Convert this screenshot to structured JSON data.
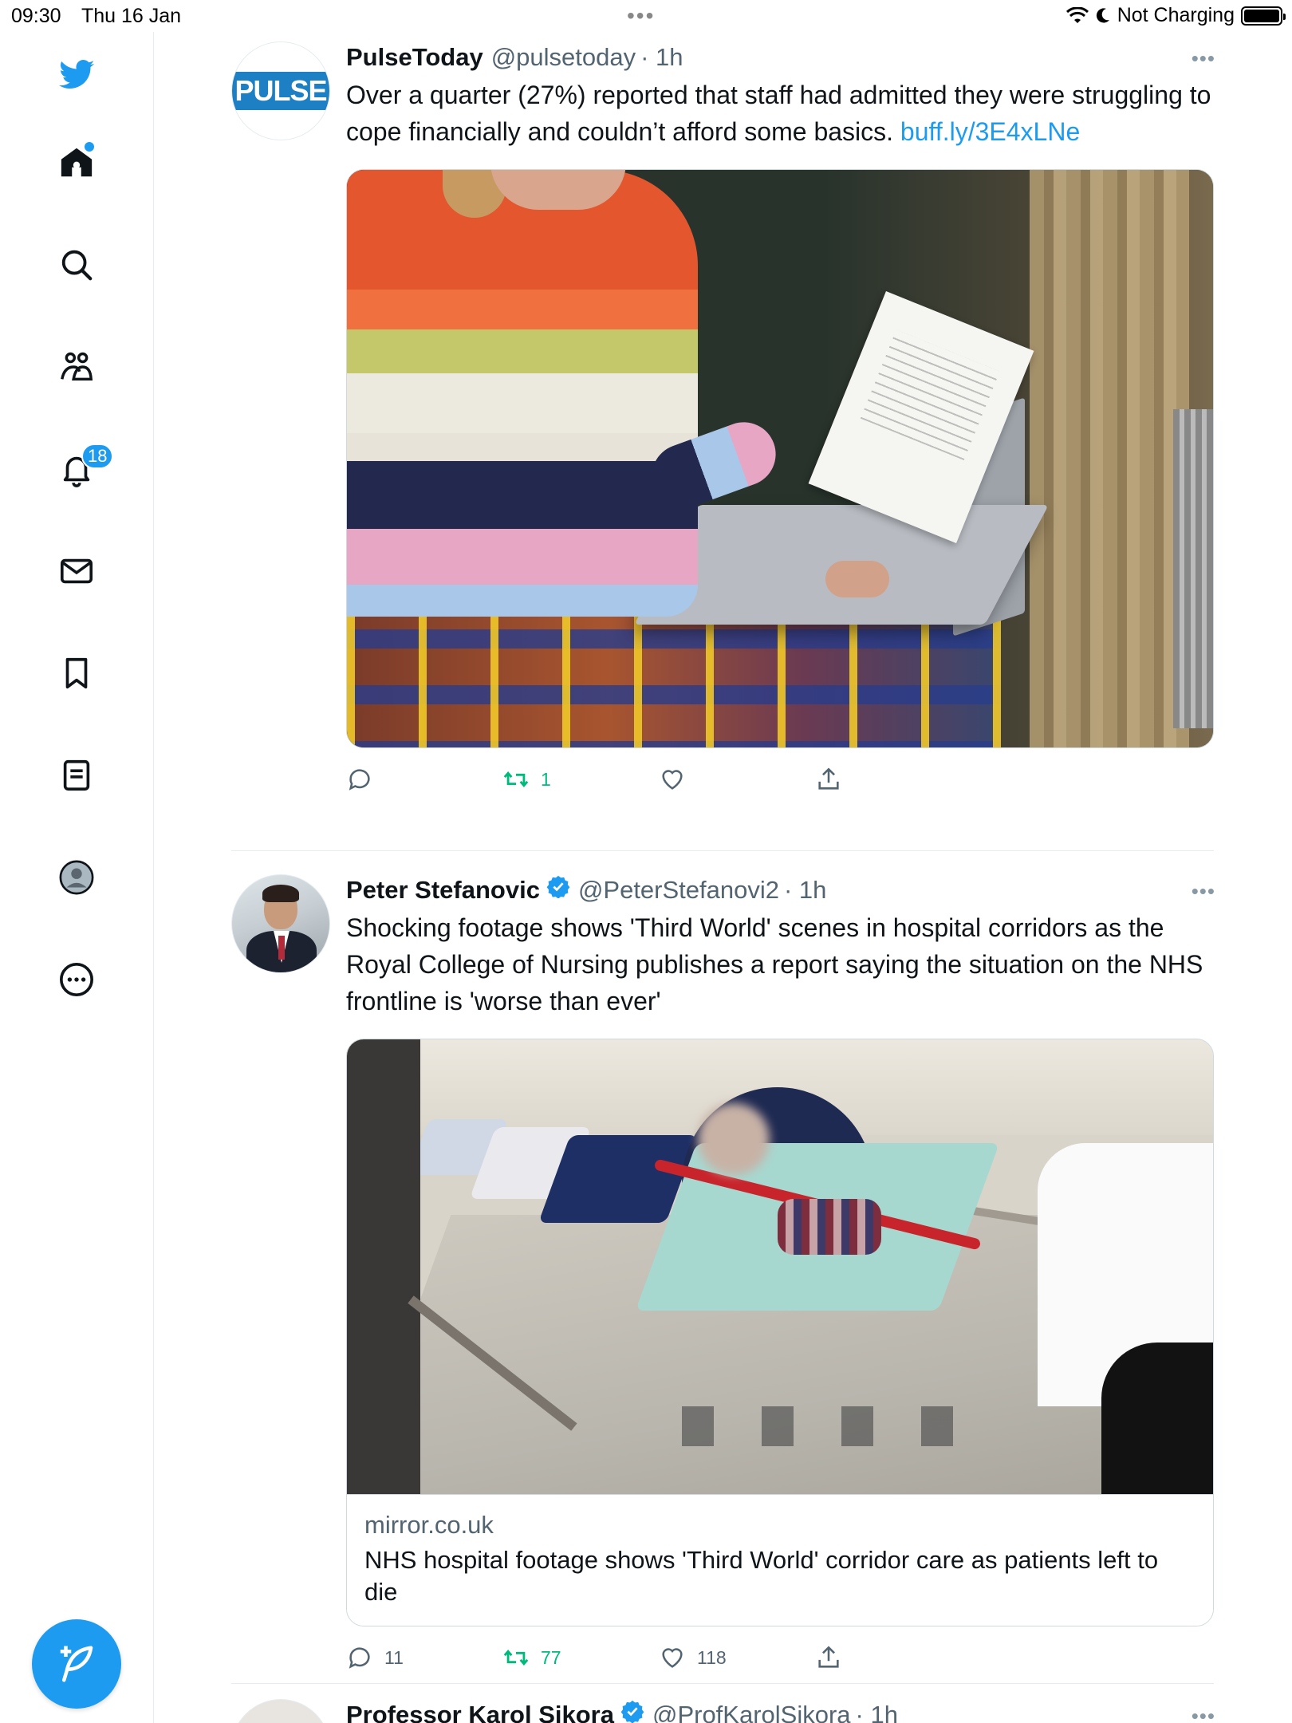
{
  "status_bar": {
    "time": "09:30",
    "date": "Thu 16 Jan",
    "charging_label": "Not Charging"
  },
  "sidebar": {
    "notifications_badge": "18",
    "accent_color": "#1d9bf0"
  },
  "tweets": [
    {
      "name": "PulseToday",
      "handle": "@pulsetoday",
      "time": "· 1h",
      "avatar_logo_text": "PULSE",
      "text": "Over a quarter (27%) reported that staff had admitted they were struggling to cope financially and couldn’t afford some basics.",
      "link": "buff.ly/3E4xLNe",
      "replies": "",
      "retweets": "1",
      "likes": ""
    },
    {
      "name": "Peter Stefanovic",
      "handle": "@PeterStefanovi2",
      "time": "· 1h",
      "text": "Shocking footage shows 'Third World' scenes in hospital corridors as the Royal College of Nursing publishes a report saying the situation on the NHS frontline is 'worse than ever'",
      "card_domain": "mirror.co.uk",
      "card_title": "NHS hospital footage shows 'Third World' corridor care as patients left to die",
      "replies": "11",
      "retweets": "77",
      "likes": "118"
    },
    {
      "name": "Professor Karol Sikora",
      "handle": "@ProfKarolSikora",
      "time": "· 1h"
    }
  ]
}
